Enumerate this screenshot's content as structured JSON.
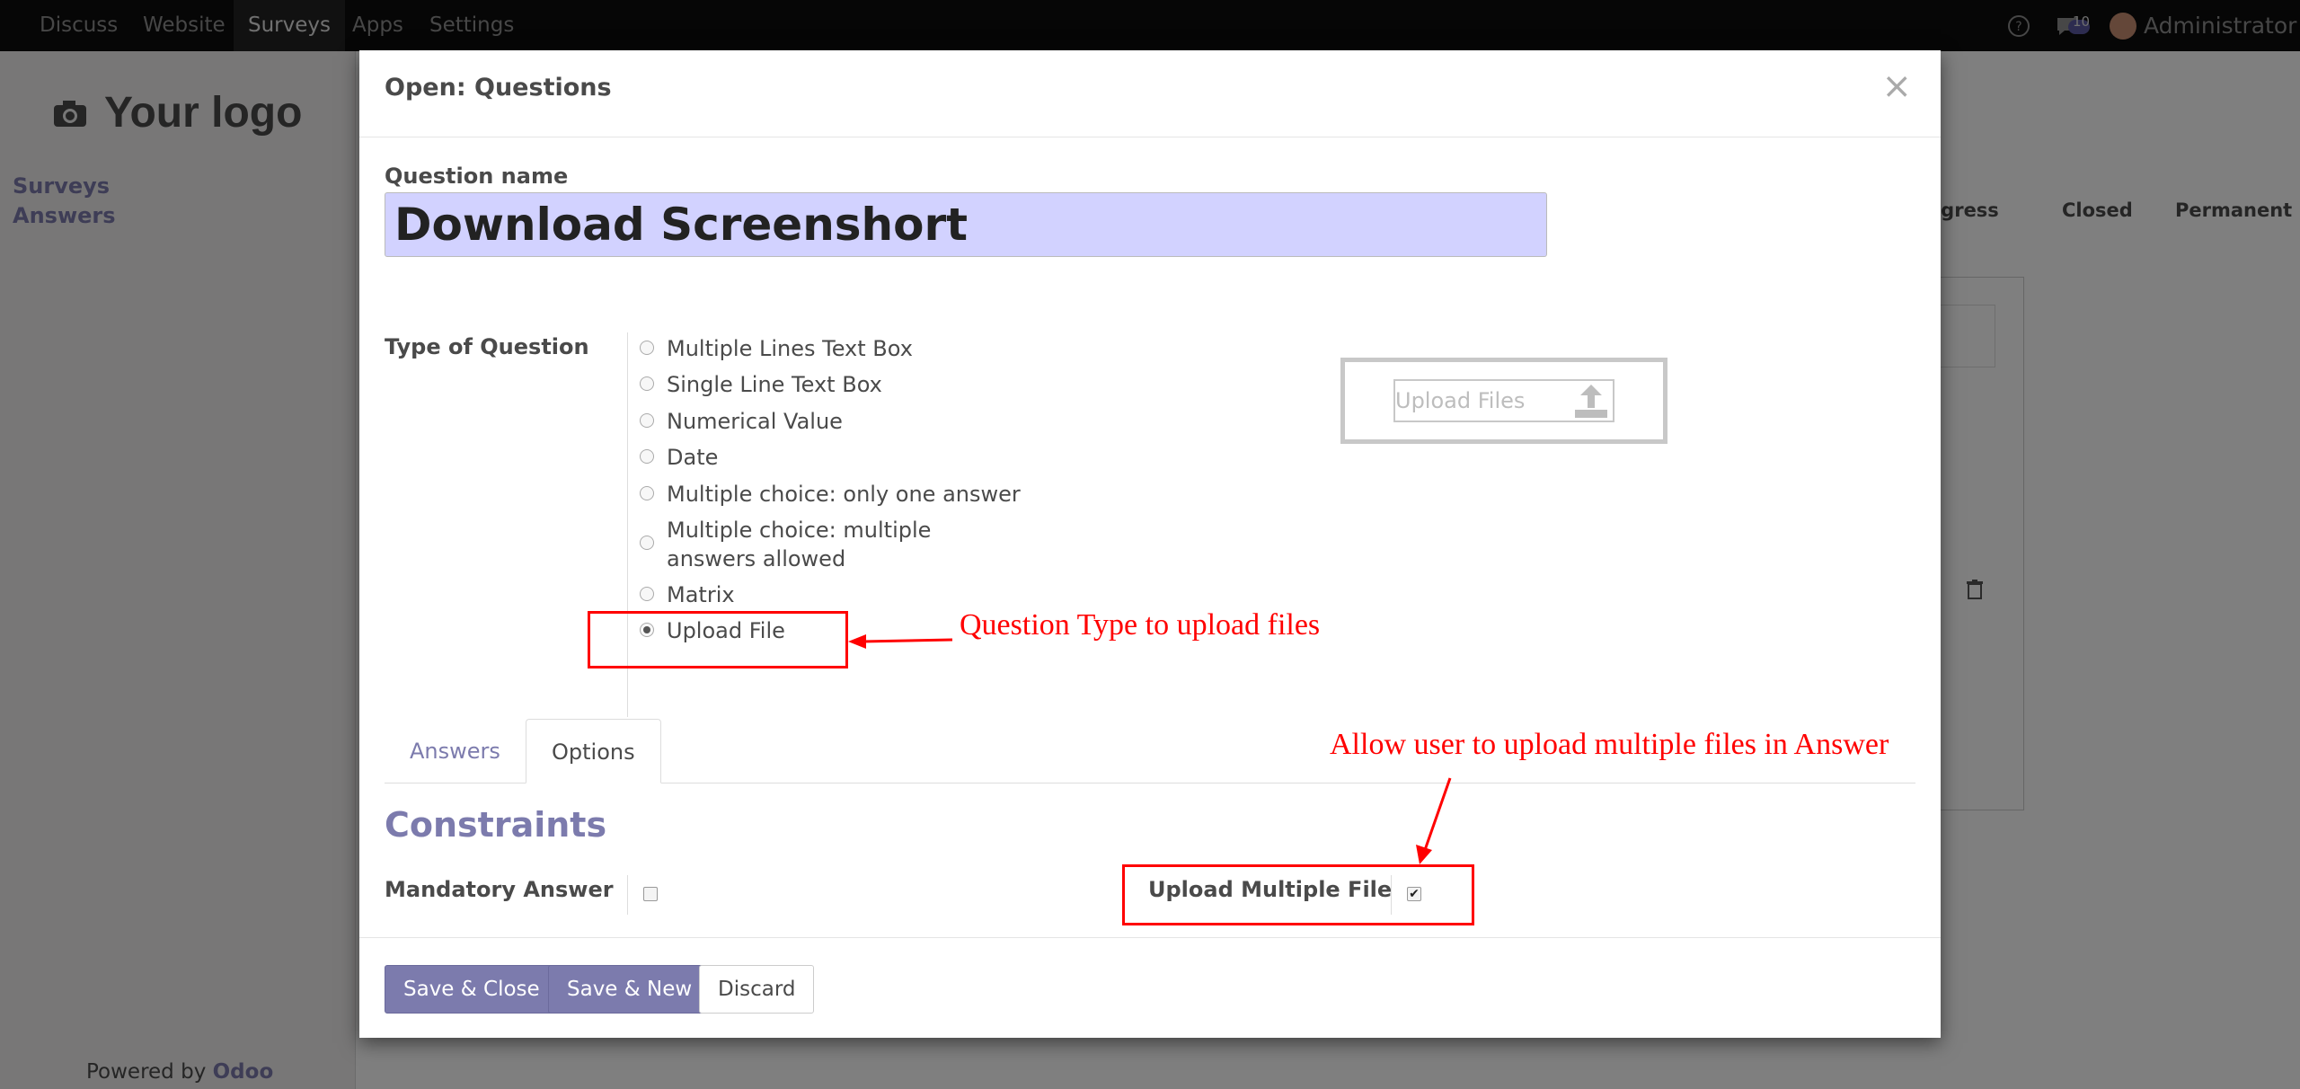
{
  "navbar": {
    "items": [
      "Discuss",
      "Website",
      "Surveys",
      "Apps",
      "Settings"
    ],
    "active": "Surveys",
    "message_count": "10",
    "user": "Administrator"
  },
  "sidebar": {
    "logo": "Your logo",
    "links": [
      "Surveys",
      "Answers"
    ],
    "powered_prefix": "Powered by",
    "powered_brand": "Odoo"
  },
  "statusbar": [
    "Progress",
    "Closed",
    "Permanent"
  ],
  "modal": {
    "title": "Open: Questions",
    "question_name_label": "Question name",
    "question_name_value": "Download Screenshort",
    "type_label": "Type of Question",
    "types": [
      "Multiple Lines Text Box",
      "Single Line Text Box",
      "Numerical Value",
      "Date",
      "Multiple choice: only one answer",
      "Multiple choice: multiple answers allowed",
      "Matrix",
      "Upload File"
    ],
    "selected_type": "Upload File",
    "upload_widget_label": "Upload Files",
    "tabs": [
      "Answers",
      "Options"
    ],
    "active_tab": "Options",
    "section_title": "Constraints",
    "mandatory_label": "Mandatory Answer",
    "mandatory_checked": false,
    "multi_upload_label": "Upload Multiple File",
    "multi_upload_checked": true,
    "buttons": {
      "save_close": "Save & Close",
      "save_new": "Save & New",
      "discard": "Discard"
    }
  },
  "annotations": {
    "question_type_note": "Question Type to upload files",
    "multi_upload_note": "Allow user to upload multiple files in Answer"
  },
  "colors": {
    "accent": "#7c7bad",
    "annotation": "#ff0000",
    "name_field_bg": "#d2d2ff"
  }
}
